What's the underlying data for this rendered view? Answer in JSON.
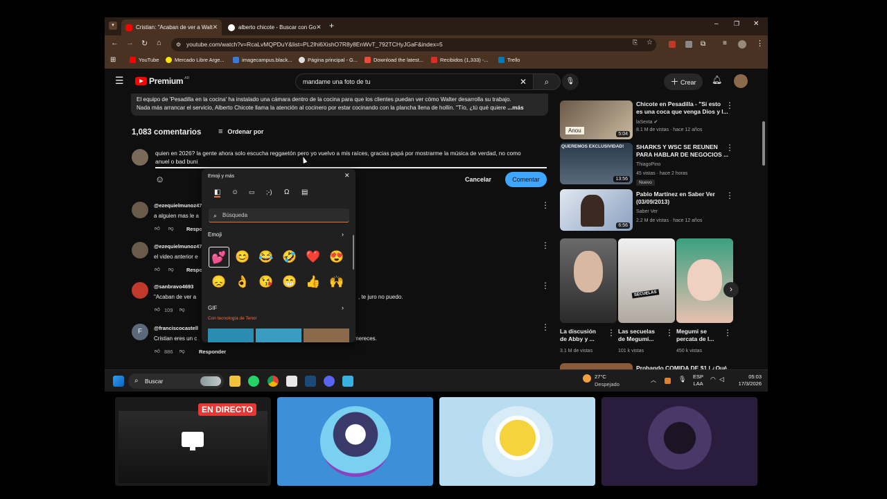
{
  "browser": {
    "tabs": [
      {
        "title": "Cristian: \"Acaban de ver a Walt",
        "active": true
      },
      {
        "title": "alberto chicote - Buscar con Go",
        "active": false
      }
    ],
    "new_tab": "+",
    "url": "youtube.com/watch?v=RcaLvMQPDuY&list=PL2Ihi6XishO7R8y8EnWvT_792TCHyJGaF&index=5",
    "bookmarks": [
      "YouTube",
      "Mercado Libre Arge...",
      "imagecampus.black...",
      "Página principal - G...",
      "Download the latest...",
      "Recibidos (1,333) -...",
      "Trello"
    ]
  },
  "youtube": {
    "logo": "Premium",
    "country": "AR",
    "search_value": "mandame una foto de tu",
    "create_label": "Crear",
    "description_line1": "El equipo de 'Pesadilla en la cocina' ha instalado una cámara dentro de la cocina para que los clientes puedan ver cómo Walter desarrolla su trabajo.",
    "description_line2": "Nada más arrancar el servicio, Alberto Chicote llama la atención al cocinero por estar cocinando con la plancha llena de hollín. \"Tío, ¿tú qué quiere",
    "description_more": "...más",
    "comment_count": "1,083 comentarios",
    "sort_label": "Ordenar por",
    "draft_line1": "quien en 2026? la gente ahora solo escucha reggaetón pero yo vuelvo a mis raíces, gracias papá por mostrarme la música de verdad, no como",
    "draft_line2": "anuel o bad buni",
    "cancel_label": "Cancelar",
    "comment_label": "Comentar",
    "comments": [
      {
        "author": "@ezequielmunoz47",
        "text": "a alguien mas le a",
        "likes": "",
        "reply": "Respo"
      },
      {
        "author": "@ezequielmunoz47",
        "text": "el video anterior e",
        "likes": "",
        "reply": "Respo"
      },
      {
        "author": "@sanbravo4693",
        "text": "\"Acaban de ver a",
        "text_right": ", te juro no puedo.",
        "likes": "109",
        "reply": "Responder"
      },
      {
        "author": "@franciscocastell",
        "avatar_letter": "F",
        "text": "Cristian eres un c",
        "text_right": "mereces.",
        "likes": "886",
        "reply": "Responder"
      }
    ]
  },
  "emoji_panel": {
    "title": "Emoji y más",
    "search_placeholder": "Búsqueda",
    "section_emoji": "Emoji",
    "section_gif": "GIF",
    "tenor": "Con tecnología de Tenor",
    "emojis_row1": [
      "💕",
      "😊",
      "😂",
      "🤣",
      "❤️",
      "😍"
    ],
    "emojis_row2": [
      "😞",
      "👌",
      "😘",
      "😁",
      "👍",
      "🙌"
    ]
  },
  "sidebar": {
    "videos": [
      {
        "title1": "Chicote en Pesadilla - \"Si esto",
        "title2": "es una coca que venga Dios y l...",
        "channel": "laSexta",
        "meta": "8.1 M de vistas · hace 12 años",
        "duration": "5:04",
        "thumb_text": "Anou"
      },
      {
        "title1": "SHARKS Y WSC SE REUNEN",
        "title2": "PARA HABLAR DE NEGOCIOS ...",
        "channel": "ThiagoPino",
        "meta": "45 vistas · hace 2 horas",
        "badge": "Nuevo",
        "duration": "13:56",
        "thumb_text": "QUEREMOS EXCLUSIVIDAD!"
      },
      {
        "title1": "Pablo Martínez en Saber Ver",
        "title2": "(03/09/2013)",
        "channel": "Saber Ver",
        "meta": "2.2 M de vistas · hace 12 años",
        "duration": "6:56"
      }
    ],
    "shorts": [
      {
        "title1": "La discusión",
        "title2": "de Abby y ...",
        "views": "3.1 M de vistas"
      },
      {
        "title1": "Las secuelas",
        "title2": "de Megumi...",
        "views": "101 k vistas",
        "thumb_text": "SECUELAS"
      },
      {
        "title1": "Megumi se",
        "title2": "percata de l...",
        "views": "450 k vistas"
      }
    ],
    "next_title": "Probando COMIDA DE $1 | ¿Qué"
  },
  "taskbar": {
    "search_label": "Buscar",
    "weather_temp": "27°C",
    "weather_desc": "Despejado",
    "lang1": "ESP",
    "lang2": "LAA",
    "time": "05:03",
    "date": "17/3/2026"
  },
  "call": {
    "live_label": "EN DIRECTO"
  },
  "colors": {
    "accent_blue": "#3ea6ff",
    "youtube_red": "#ff0000",
    "chrome_brown": "#4a3222"
  }
}
